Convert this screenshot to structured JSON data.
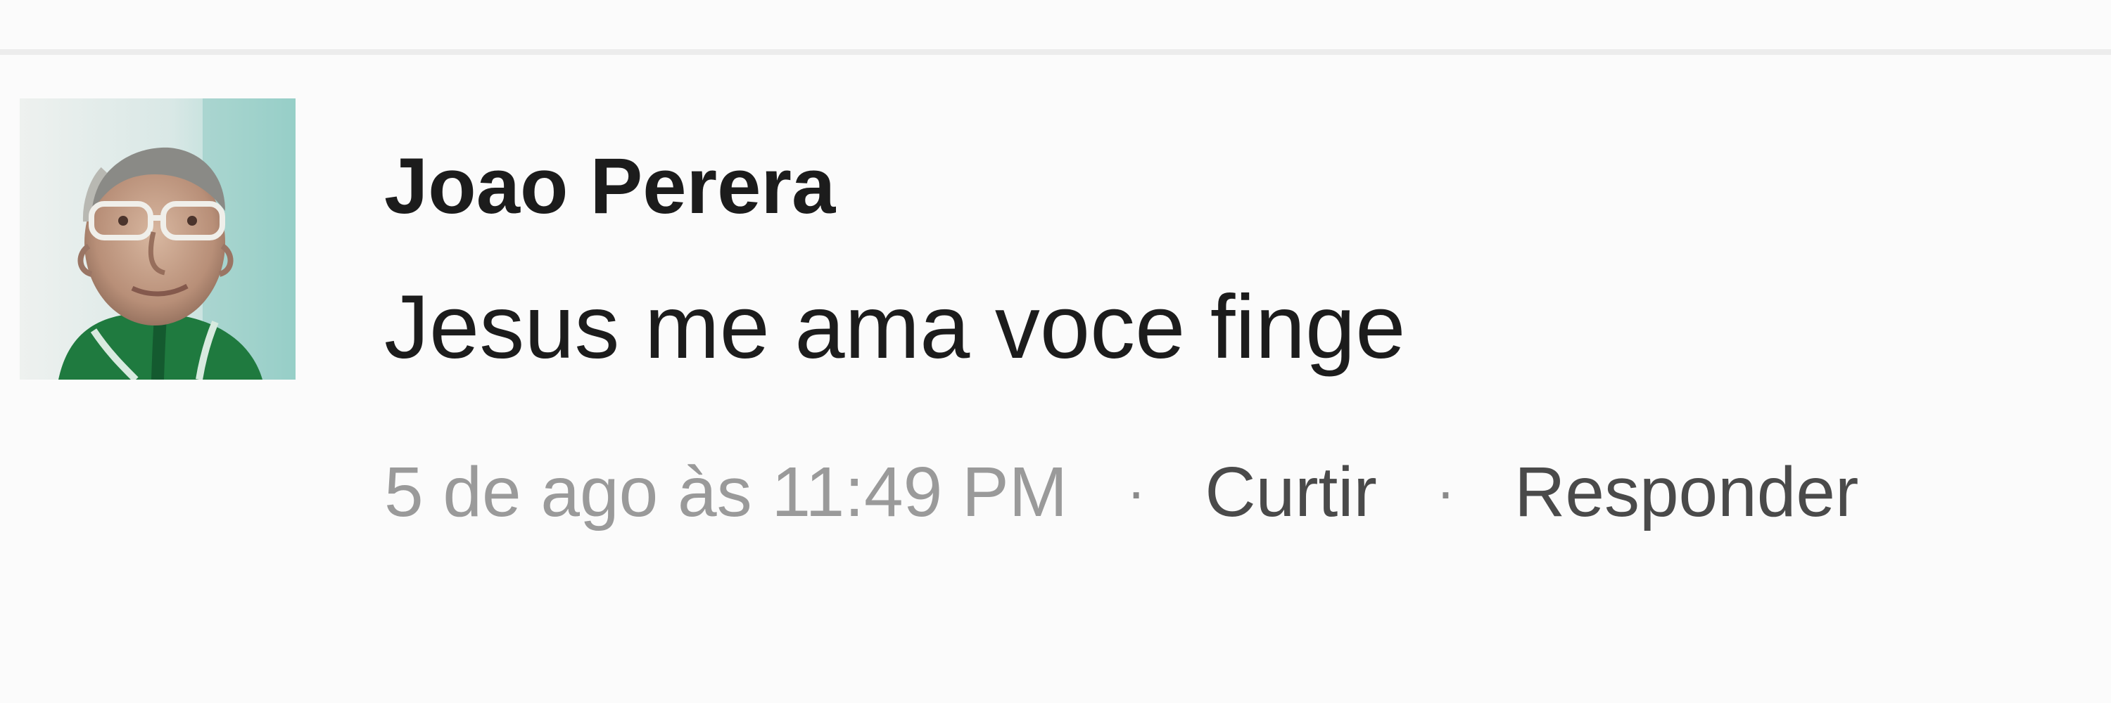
{
  "comment": {
    "author_name": "Joao Perera",
    "text": "Jesus me ama voce finge",
    "timestamp": "5 de ago às 11:49 PM",
    "actions": {
      "like_label": "Curtir",
      "reply_label": "Responder",
      "separator": "·"
    }
  },
  "colors": {
    "background": "#fbfbfb",
    "text_primary": "#1c1c1c",
    "text_muted": "#9a9a9a",
    "text_action": "#4a4a4a",
    "avatar_jersey": "#1f7a3f"
  },
  "icons": {
    "avatar": "profile-photo"
  }
}
